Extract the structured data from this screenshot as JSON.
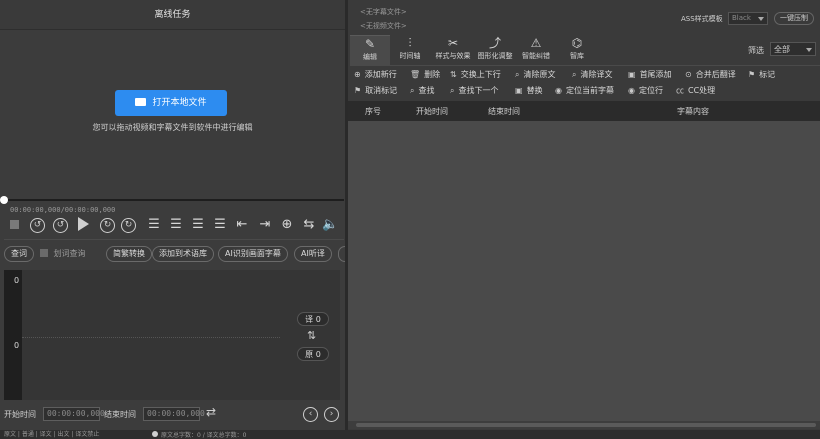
{
  "left_header": {
    "title": "离线任务"
  },
  "drop_zone": {
    "open_button": "打开本地文件",
    "hint": "您可以拖动视频和字幕文件到软件中进行编辑"
  },
  "timecode": "00:00:00,000/00:00:00,000",
  "toolbar_row2": [
    "查词",
    "划词查询",
    "简繁转换",
    "添加到术语库",
    "AI识别画面字幕",
    "AI听译"
  ],
  "waveform": {
    "top_value": "0",
    "bottom_value": "0",
    "translate_count": "译 0",
    "source_count": "原 0"
  },
  "bottom_bar": {
    "start_label": "开始时间",
    "start_value": "00:00:00,000",
    "end_label": "结束时间",
    "end_value": "00:00:00,000"
  },
  "status_bar": {
    "left": "原文 | 普通 | 译文 | 出文 | 译文禁止",
    "right": "原文总字数：0 / 译文总字数：0"
  },
  "right_header": {
    "subtitle_file": "<无字幕文件>",
    "video_file": "<无视频文件>",
    "template_label": "ASS样式模板",
    "template_value": "Black",
    "compress_button": "一键压制"
  },
  "tabs": [
    {
      "label": "编辑",
      "icon": "✎"
    },
    {
      "label": "时间轴",
      "icon": "⫶"
    },
    {
      "label": "样式与效果",
      "icon": "✂"
    },
    {
      "label": "图形化调整",
      "icon": "⤴"
    },
    {
      "label": "智能纠错",
      "icon": "⚠"
    },
    {
      "label": "智库",
      "icon": "⌬"
    }
  ],
  "filter": {
    "label": "筛选",
    "value": "全部"
  },
  "actions_row1": [
    {
      "icon": "⊕",
      "label": "添加新行"
    },
    {
      "icon": "🗑",
      "label": "删除"
    },
    {
      "icon": "⇅",
      "label": "交换上下行"
    },
    {
      "icon": "⌕",
      "label": "清除原文"
    },
    {
      "icon": "⌕",
      "label": "清除译文"
    },
    {
      "icon": "▣",
      "label": "首尾添加"
    },
    {
      "icon": "⊙",
      "label": "合并后翻译"
    },
    {
      "icon": "⚑",
      "label": "标记"
    }
  ],
  "actions_row2": [
    {
      "icon": "⚑",
      "label": "取消标记"
    },
    {
      "icon": "⌕",
      "label": "查找"
    },
    {
      "icon": "⌕",
      "label": "查找下一个"
    },
    {
      "icon": "▣",
      "label": "替换"
    },
    {
      "icon": "◉",
      "label": "定位当前字幕"
    },
    {
      "icon": "◉",
      "label": "定位行"
    },
    {
      "icon": "㏄",
      "label": "CC处理"
    }
  ],
  "table_headers": [
    "序号",
    "开始时间",
    "结束时间",
    "字幕内容"
  ],
  "colors": {
    "accent": "#2d8cf0",
    "panel": "#3a3a3a",
    "dark": "#2a2a2a",
    "table_header": "#2b2b2b"
  }
}
